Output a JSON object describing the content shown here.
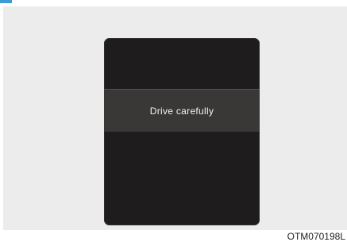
{
  "display": {
    "message": "Drive carefully"
  },
  "figure": {
    "code": "OTM070198L"
  },
  "colors": {
    "accent_tab": "#3f9bd3",
    "panel_background": "#ececec",
    "screen_background": "#1e1c1c",
    "message_band": "#3a3837",
    "message_text": "#f2f2f2"
  }
}
